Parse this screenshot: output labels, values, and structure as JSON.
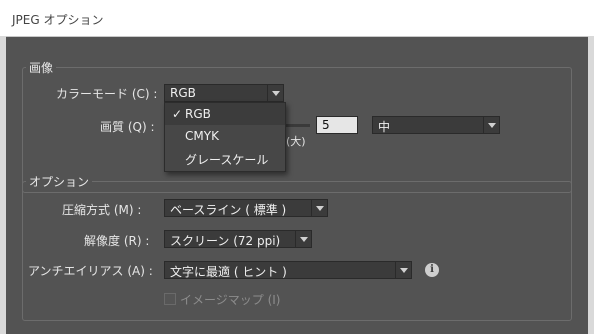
{
  "window": {
    "title": "JPEG オプション"
  },
  "image_group": {
    "legend": "画像",
    "color_mode": {
      "label": "カラーモード (C) :",
      "value": "RGB",
      "options": [
        "RGB",
        "CMYK",
        "グレースケール"
      ]
    },
    "quality": {
      "label": "画質 (Q) :",
      "value": "5",
      "hint_large": "(大)",
      "preset": "中"
    }
  },
  "options_group": {
    "legend": "オプション",
    "compression": {
      "label": "圧縮方式 (M) :",
      "value": "ベースライン ( 標準 )"
    },
    "resolution": {
      "label": "解像度 (R) :",
      "value": "スクリーン (72 ppi)"
    },
    "antialias": {
      "label": "アンチエイリアス (A) :",
      "value": "文字に最適 ( ヒント )",
      "info": "i"
    },
    "imagemap": {
      "label": "イメージマップ (I)",
      "checked": false,
      "enabled": false
    }
  },
  "dropdown": {
    "check_mark": "✓",
    "selected_index": 0
  }
}
